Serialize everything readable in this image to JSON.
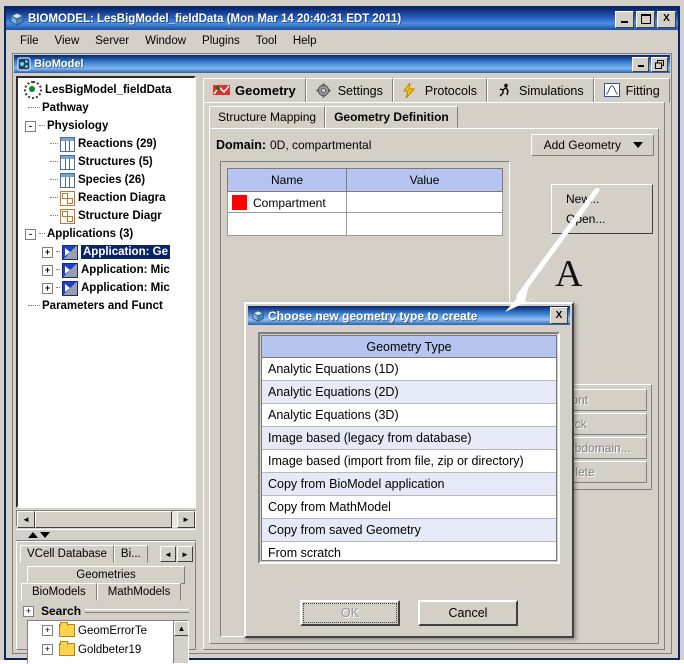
{
  "window": {
    "title": "BIOMODEL: LesBigModel_fieldData (Mon Mar 14 20:40:31 EDT 2011)",
    "icon": "biomodel-icon",
    "buttons": {
      "minimize": "_",
      "maximize": "□",
      "close": "X"
    }
  },
  "menubar": {
    "items": [
      "File",
      "View",
      "Server",
      "Window",
      "Plugins",
      "Tool",
      "Help"
    ]
  },
  "mdi": {
    "title": "BioModel",
    "icon": "biomodel-small-icon",
    "buttons": {
      "minimize": "_",
      "restore": "❐"
    }
  },
  "tree": {
    "nodes": [
      {
        "label": "LesBigModel_fieldDatа",
        "icon": "model-icon",
        "depth": 0,
        "expander": "",
        "selected": false
      },
      {
        "label": "Pathway",
        "icon": "",
        "depth": 1,
        "expander": "",
        "selected": false
      },
      {
        "label": "Physiology",
        "icon": "",
        "depth": 0,
        "expander": "-",
        "selected": false
      },
      {
        "label": "Reactions (29)",
        "icon": "grid-icon",
        "depth": 2,
        "expander": "",
        "selected": false
      },
      {
        "label": "Structures (5)",
        "icon": "grid-icon",
        "depth": 2,
        "expander": "",
        "selected": false
      },
      {
        "label": "Species (26)",
        "icon": "grid-icon",
        "depth": 2,
        "expander": "",
        "selected": false
      },
      {
        "label": "Reaction Diagra",
        "icon": "diagram-icon",
        "depth": 2,
        "expander": "",
        "selected": false
      },
      {
        "label": "Structure Diagr",
        "icon": "diagram-icon",
        "depth": 2,
        "expander": "",
        "selected": false
      },
      {
        "label": "Applications (3)",
        "icon": "",
        "depth": 0,
        "expander": "-",
        "selected": false
      },
      {
        "label": "Application: Ge",
        "icon": "application-icon",
        "depth": 1,
        "expander": "+",
        "selected": true
      },
      {
        "label": "Application: Mic",
        "icon": "application-icon",
        "depth": 1,
        "expander": "+",
        "selected": false
      },
      {
        "label": "Application: Mic",
        "icon": "application-icon",
        "depth": 1,
        "expander": "+",
        "selected": false
      },
      {
        "label": "Parameters and Funct",
        "icon": "",
        "depth": 1,
        "expander": "",
        "selected": false
      }
    ]
  },
  "database_panel": {
    "tabs": [
      "VCell Database",
      "Bi..."
    ],
    "nav": {
      "prev": "◄",
      "next": "►"
    },
    "geometries_button": "Geometries",
    "model_tabs": [
      "BioModels",
      "MathModels"
    ],
    "search_label": "Search",
    "search_expander": "+",
    "rows": [
      {
        "label": "GeomErrorTe",
        "icon": "folder-icon",
        "expander": "+"
      },
      {
        "label": "Goldbeter19",
        "icon": "folder-icon",
        "expander": "+"
      }
    ]
  },
  "tabs": [
    {
      "label": "Geometry",
      "icon": "geometry-icon",
      "active": true
    },
    {
      "label": "Settings",
      "icon": "gear-icon",
      "active": false
    },
    {
      "label": "Protocols",
      "icon": "lightning-icon",
      "active": false
    },
    {
      "label": "Simulations",
      "icon": "runner-icon",
      "active": false
    },
    {
      "label": "Fitting",
      "icon": "curve-icon",
      "active": false
    }
  ],
  "subtabs": [
    {
      "label": "Structure Mapping",
      "active": false
    },
    {
      "label": "Geometry Definition",
      "active": true
    }
  ],
  "geometry_definition": {
    "domain_label": "Domain:",
    "domain_value": "0D, compartmental",
    "add_geometry_button": "Add Geometry",
    "add_geometry_menu": [
      "New...",
      "Open..."
    ],
    "table": {
      "headers": [
        "Name",
        "Value"
      ],
      "rows": [
        {
          "color": "#ff0000",
          "name": "Compartment",
          "value": ""
        }
      ]
    },
    "side_buttons": [
      "Front",
      "Back",
      "Subdomain...",
      "Delete"
    ]
  },
  "dialog": {
    "title": "Choose new geometry type to create",
    "icon": "biomodel-small-icon",
    "close_label": "X",
    "list_header": "Geometry Type",
    "items": [
      "Analytic Equations (1D)",
      "Analytic Equations (2D)",
      "Analytic Equations (3D)",
      "Image based (legacy from database)",
      "Image based (import from file, zip or directory)",
      "Copy from BioModel application",
      "Copy from MathModel",
      "Copy from saved Geometry",
      "From scratch"
    ],
    "ok_label": "OK",
    "cancel_label": "Cancel"
  },
  "annotation": {
    "label": "A",
    "arrow": "white-arrow-pointing-to-dialog-title"
  },
  "colors": {
    "titlebar_blue": "#0a246a",
    "face": "#d4d0c8",
    "header_blue": "#b6c4ef",
    "row_alt": "#e6eaf8",
    "swatch_red": "#ff0000"
  }
}
